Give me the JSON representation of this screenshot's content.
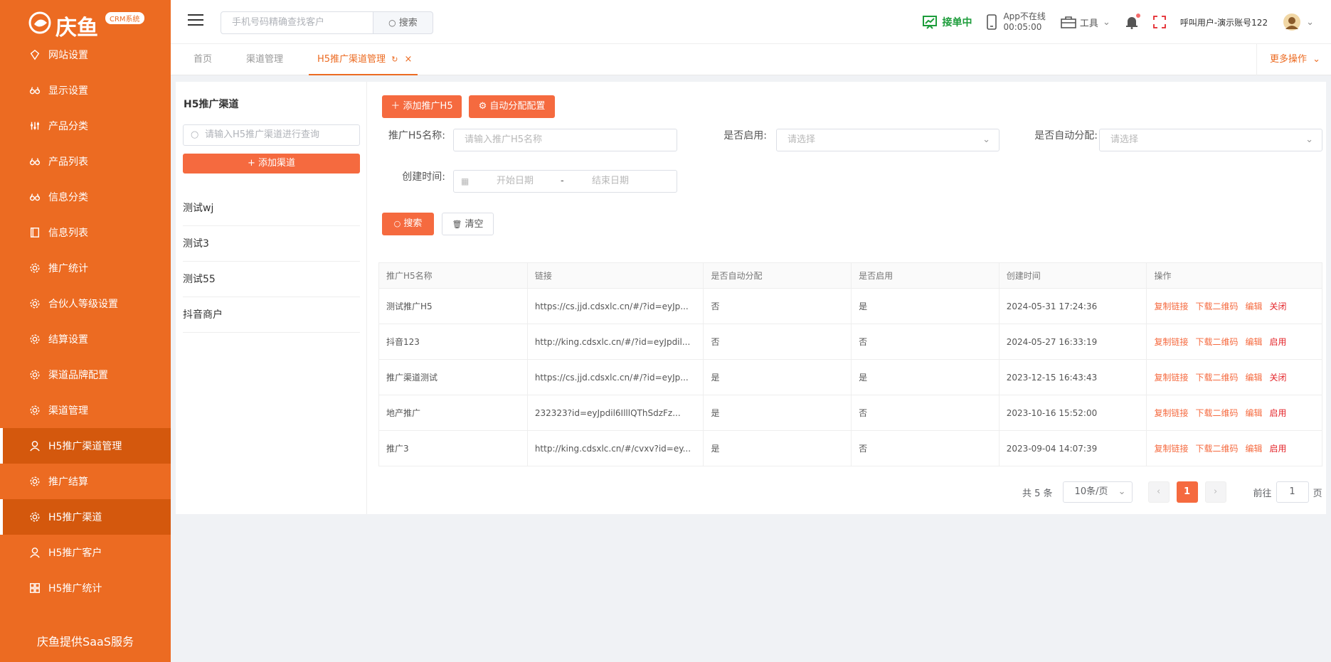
{
  "brand": {
    "name": "庆鱼",
    "tag": "CRM系统",
    "footer": "庆鱼提供SaaS服务"
  },
  "sidebar": {
    "items": [
      {
        "label": "网站设置",
        "icon": "diamond-icon",
        "active": false
      },
      {
        "label": "显示设置",
        "icon": "glasses-icon",
        "active": false
      },
      {
        "label": "产品分类",
        "icon": "sliders-icon",
        "active": false
      },
      {
        "label": "产品列表",
        "icon": "glasses-icon",
        "active": false
      },
      {
        "label": "信息分类",
        "icon": "glasses-icon",
        "active": false
      },
      {
        "label": "信息列表",
        "icon": "book-icon",
        "active": false
      },
      {
        "label": "推广统计",
        "icon": "gear-icon",
        "active": false
      },
      {
        "label": "合伙人等级设置",
        "icon": "gear-icon",
        "active": false
      },
      {
        "label": "结算设置",
        "icon": "gear-icon",
        "active": false
      },
      {
        "label": "渠道品牌配置",
        "icon": "gear-icon",
        "active": false
      },
      {
        "label": "渠道管理",
        "icon": "gear-icon",
        "active": false
      },
      {
        "label": "H5推广渠道管理",
        "icon": "user-icon",
        "active": true
      },
      {
        "label": "推广结算",
        "icon": "gear-icon",
        "active": false
      },
      {
        "label": "H5推广渠道",
        "icon": "gear-icon",
        "active": true
      },
      {
        "label": "H5推广客户",
        "icon": "user-icon",
        "active": false
      },
      {
        "label": "H5推广统计",
        "icon": "grid-icon",
        "active": false
      }
    ]
  },
  "header": {
    "search_placeholder": "手机号码精确查找客户",
    "search_btn": "搜索",
    "receiving": "接单中",
    "app_status": "App不在线",
    "app_time": "00:05:00",
    "tools": "工具",
    "user": "呼叫用户-演示账号122"
  },
  "tabs": [
    {
      "label": "首页"
    },
    {
      "label": "渠道管理"
    },
    {
      "label": "H5推广渠道管理"
    }
  ],
  "more_ops": "更多操作",
  "left_panel": {
    "title": "H5推广渠道",
    "search_placeholder": "请输入H5推广渠道进行查询",
    "add_btn": "+ 添加渠道",
    "items": [
      "测试wj",
      "测试3",
      "测试55",
      "抖音商户"
    ]
  },
  "toolbar": {
    "add_h5": "添加推广H5",
    "auto_assign": "自动分配配置"
  },
  "filters": {
    "name_label": "推广H5名称:",
    "name_placeholder": "请输入推广H5名称",
    "enabled_label": "是否启用:",
    "enabled_placeholder": "请选择",
    "auto_label": "是否自动分配:",
    "auto_placeholder": "请选择",
    "time_label": "创建时间:",
    "start_placeholder": "开始日期",
    "sep": "-",
    "end_placeholder": "结束日期",
    "search_btn": "搜索",
    "clear_btn": "清空"
  },
  "table": {
    "columns": [
      "推广H5名称",
      "链接",
      "是否自动分配",
      "是否启用",
      "创建时间",
      "操作"
    ],
    "rows": [
      {
        "name": "测试推广H5",
        "link": "https://cs.jjd.cdsxlc.cn/#/?id=eyJp...",
        "auto": "否",
        "enabled": "是",
        "created": "2024-05-31 17:24:36",
        "toggle": "关闭"
      },
      {
        "name": "抖音123",
        "link": "http://king.cdsxlc.cn/#/?id=eyJpdil...",
        "auto": "否",
        "enabled": "否",
        "created": "2024-05-27 16:33:19",
        "toggle": "启用"
      },
      {
        "name": "推广渠道测试",
        "link": "https://cs.jjd.cdsxlc.cn/#/?id=eyJp...",
        "auto": "是",
        "enabled": "是",
        "created": "2023-12-15 16:43:43",
        "toggle": "关闭"
      },
      {
        "name": "地产推广",
        "link": "232323?id=eyJpdil6IlllQThSdzFz...",
        "auto": "是",
        "enabled": "否",
        "created": "2023-10-16 15:52:00",
        "toggle": "启用"
      },
      {
        "name": "推广3",
        "link": "http://king.cdsxlc.cn/#/cvxv?id=ey...",
        "auto": "是",
        "enabled": "否",
        "created": "2023-09-04 14:07:39",
        "toggle": "启用"
      }
    ],
    "actions": {
      "copy": "复制链接",
      "download": "下载二维码",
      "edit": "编辑"
    }
  },
  "pagination": {
    "total": "共 5 条",
    "page_size": "10条/页",
    "current": "1",
    "goto_label": "前往",
    "goto_value": "1",
    "page_unit": "页"
  },
  "colors": {
    "accent": "#ec6b22",
    "button": "#f56a3f",
    "danger": "#e4262b",
    "success": "#1c9c3a"
  }
}
